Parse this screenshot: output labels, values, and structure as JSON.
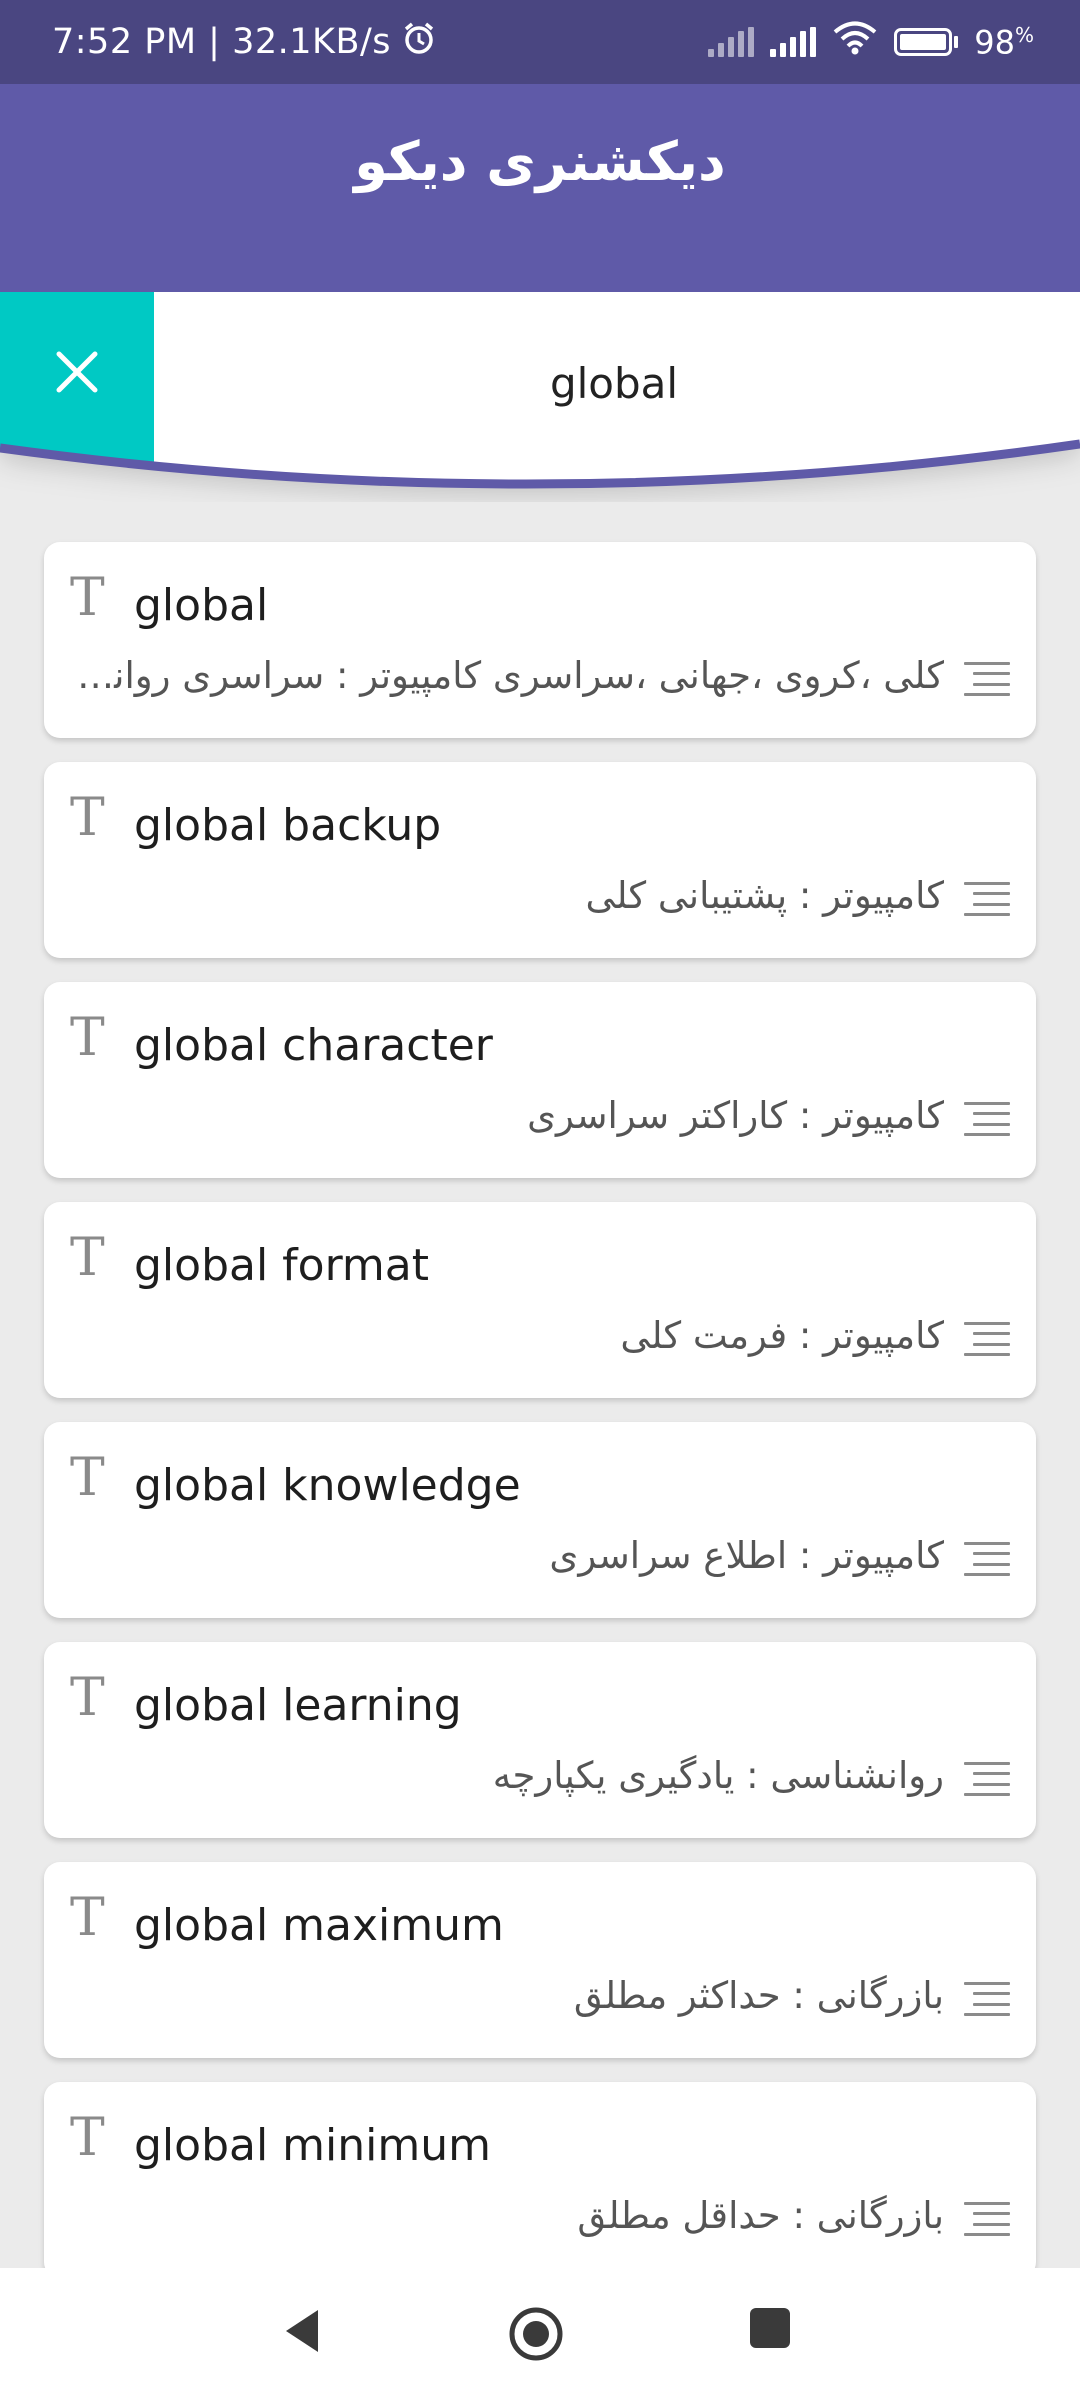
{
  "status_bar": {
    "time_speed": "7:52 PM | 32.1KB/s",
    "battery_pct": "98",
    "battery_unit": "%"
  },
  "app_bar": {
    "title": "دیکشنری دیکو"
  },
  "search": {
    "value": "global"
  },
  "colors": {
    "status_bar": "#4a4681",
    "app_bar": "#5f5aa8",
    "close_button": "#00c9c4",
    "background": "#ebebeb"
  },
  "results": [
    {
      "word": "global",
      "meaning": "کلی ،کروی ،جهانی ،سراسری کامپیوتر : سراسری روانش..."
    },
    {
      "word": "global backup",
      "meaning": "کامپیوتر : پشتیبانی کلی"
    },
    {
      "word": "global character",
      "meaning": "کامپیوتر : کاراکتر سراسری"
    },
    {
      "word": "global format",
      "meaning": "کامپیوتر : فرمت کلی"
    },
    {
      "word": "global knowledge",
      "meaning": "کامپیوتر : اطلاع سراسری"
    },
    {
      "word": "global learning",
      "meaning": "روانشناسی : یادگیری یکپارچه"
    },
    {
      "word": "global maximum",
      "meaning": "بازرگانی : حداکثر مطلق"
    },
    {
      "word": "global minimum",
      "meaning": "بازرگانی : حداقل مطلق"
    }
  ]
}
